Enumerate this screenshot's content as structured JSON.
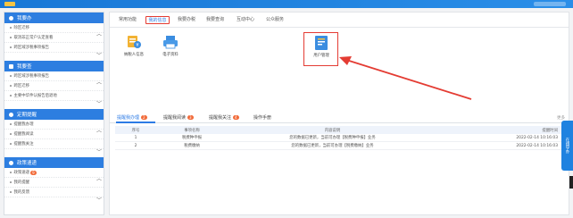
{
  "sidebar": {
    "sections": [
      {
        "title": "我要办",
        "items": [
          "除区迁移",
          "取消非正常户认定查看",
          "跨区域涉税事项报告"
        ]
      },
      {
        "title": "我要查",
        "items": [
          "跨区域涉税事项报告",
          "跨区迁移",
          "主要中华件认报告后退地"
        ]
      },
      {
        "title": "定期提醒",
        "items": [
          "提醒我办理",
          "提醒我阅读",
          "提醒我关注"
        ]
      },
      {
        "title": "政策速递",
        "items": [
          "政策速递",
          "我的提醒",
          "我的反馈"
        ],
        "badge": "9"
      }
    ]
  },
  "tabs": [
    {
      "label": "常用功能"
    },
    {
      "label": "我的信息"
    },
    {
      "label": "我要办税"
    },
    {
      "label": "我要查询"
    },
    {
      "label": "互动中心"
    },
    {
      "label": "公众服务"
    }
  ],
  "apps": [
    {
      "label": "纳税人信息"
    },
    {
      "label": "电子资料"
    },
    {
      "label": "用户管理"
    }
  ],
  "subtabs": [
    {
      "label": "提醒我办理",
      "badge": "2"
    },
    {
      "label": "提醒我阅读",
      "badge": "3"
    },
    {
      "label": "提醒我关注",
      "badge": "4"
    },
    {
      "label": "操作手册"
    }
  ],
  "more_label": "更多",
  "table": {
    "headers": [
      "序号",
      "事项名称",
      "内容说明",
      "提醒时间"
    ],
    "rows": [
      [
        "1",
        "税费种申报",
        "您的数据已更新，当前可办理【税费种申报】业务",
        "2022-02-14 10:16:03"
      ],
      [
        "2",
        "税费缴纳",
        "您的数据已更新，当前可办理【税费缴纳】业务",
        "2022-02-14 10:16:03"
      ]
    ]
  },
  "float_button": "在线导办"
}
